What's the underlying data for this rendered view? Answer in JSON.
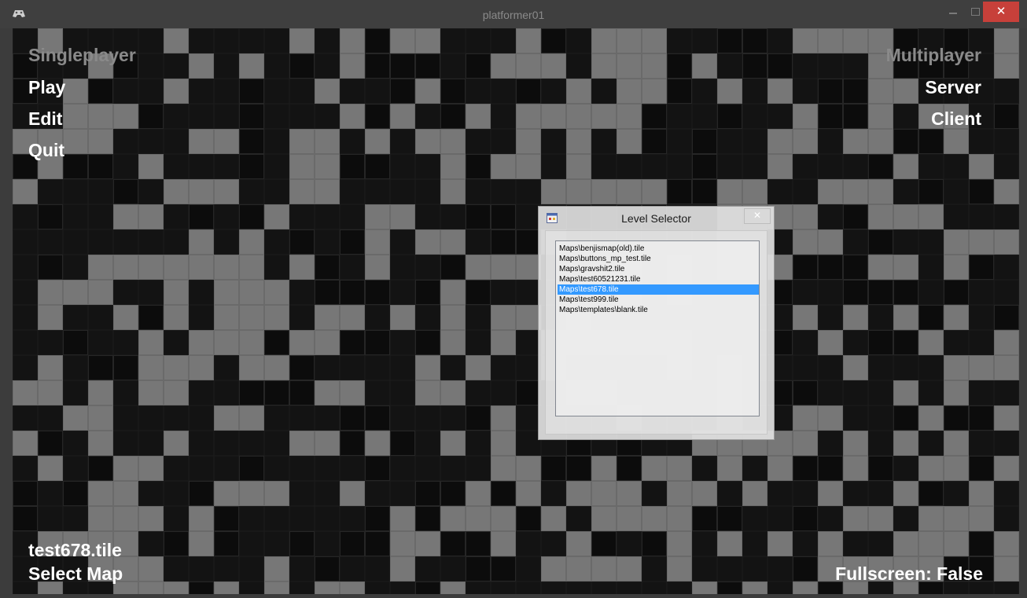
{
  "window": {
    "title": "platformer01",
    "close_glyph": "✕"
  },
  "menu": {
    "left_heading": "Singleplayer",
    "play": "Play",
    "edit": "Edit",
    "quit": "Quit",
    "right_heading": "Multiplayer",
    "server": "Server",
    "client": "Client"
  },
  "footer": {
    "current_map": "test678.tile",
    "select_map": "Select Map",
    "fullscreen": "Fullscreen: False"
  },
  "level_selector": {
    "title": "Level Selector",
    "close_glyph": "✕",
    "items": [
      "Maps\\benjismap(old).tile",
      "Maps\\buttons_mp_test.tile",
      "Maps\\gravshit2.tile",
      "Maps\\test60521231.tile",
      "Maps\\test678.tile",
      "Maps\\test999.tile",
      "Maps\\templates\\blank.tile"
    ],
    "selected_index": 4
  },
  "colors": {
    "tile_light": "#777777",
    "tile_dark": "#0c0c0c",
    "background": "#131313",
    "selection": "#3399ff"
  }
}
